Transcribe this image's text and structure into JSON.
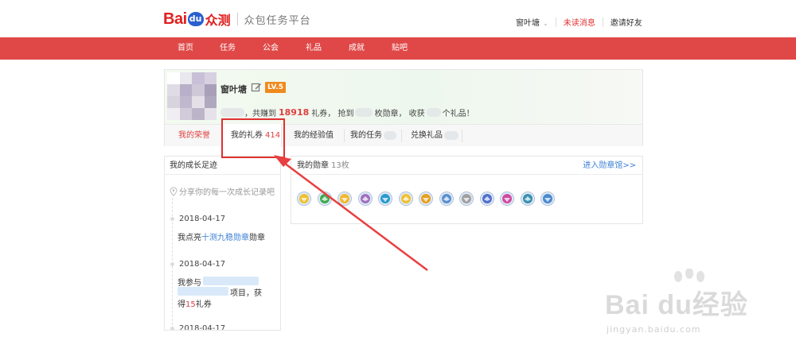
{
  "header": {
    "logo_bai": "Bai",
    "logo_du": "du",
    "logo_zc": "众测",
    "platform": "众包任务平台",
    "user": "窗叶塘",
    "unread": "未读消息",
    "invite": "邀请好友"
  },
  "nav": [
    "首页",
    "任务",
    "公会",
    "礼品",
    "成就",
    "贴吧"
  ],
  "profile": {
    "name": "窗叶塘",
    "level": "LV.5",
    "summary_prefix": "，共赚到",
    "points": "18918",
    "summary_mid1": "礼券，  抢到",
    "summary_mid2": "枚勋章，  收获",
    "summary_end": "个礼品！"
  },
  "tabs": [
    {
      "label": "我的荣誉",
      "count": ""
    },
    {
      "label": "我的礼券",
      "count": "414"
    },
    {
      "label": "我的经验值",
      "count": ""
    },
    {
      "label": "我的任务",
      "count": ""
    },
    {
      "label": "兑换礼品",
      "count": ""
    }
  ],
  "growth": {
    "title": "我的成长足迹",
    "share": "分享你的每一次成长记录吧",
    "entries": [
      {
        "date": "2018-04-17",
        "pre": "我点亮",
        "link": "十测九稳勋章",
        "post": "勋章"
      },
      {
        "date": "2018-04-17",
        "line1": "我参与",
        "line2": "项目，获",
        "line3_pre": "得",
        "line3_num": "15",
        "line3_post": "礼券"
      },
      {
        "date": "2018-04-17"
      }
    ]
  },
  "medals": {
    "title": "我的勋章",
    "count": "13枚",
    "more": "进入勋章馆>>",
    "colors": [
      "#f0c030",
      "#3caa50",
      "#f0b830",
      "#a070c0",
      "#2a9ad0",
      "#f0c030",
      "#e8a020",
      "#5a90d0",
      "#a0a0a0",
      "#5070d0",
      "#d04aa0",
      "#3a90b0",
      "#4a8ad0"
    ]
  },
  "watermark": {
    "big": "Bai du经验",
    "small": "jingyan.baidu.com"
  }
}
